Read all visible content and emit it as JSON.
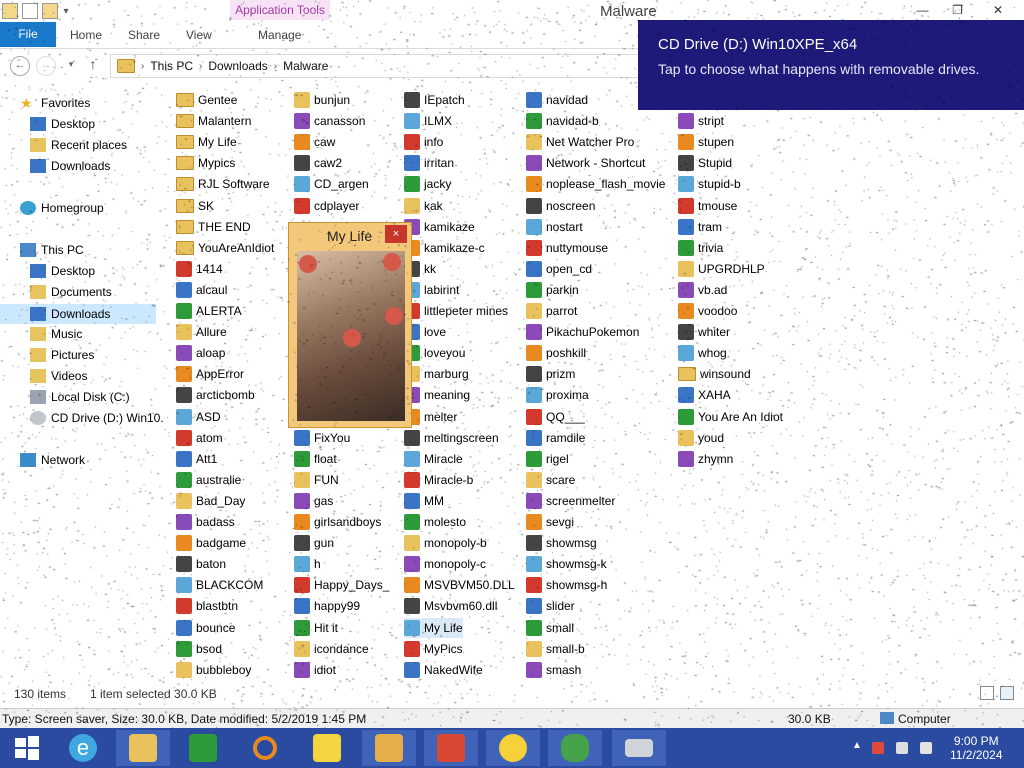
{
  "window": {
    "title": "Malware",
    "context_tab": "Application Tools",
    "minimize_glyph": "—",
    "maximize_glyph": "❐",
    "close_glyph": "✕"
  },
  "ribbon": {
    "file": "File",
    "tabs": [
      "Home",
      "Share",
      "View",
      "Manage"
    ]
  },
  "address": {
    "crumbs": [
      "This PC",
      "Downloads",
      "Malware"
    ],
    "back_glyph": "←",
    "forward_glyph": "→",
    "up_glyph": "↑"
  },
  "sidebar": {
    "items": [
      {
        "label": "Favorites",
        "icon": "star-icon"
      },
      {
        "label": "Desktop",
        "icon": "desktop-icon"
      },
      {
        "label": "Recent places",
        "icon": "recent-places-icon"
      },
      {
        "label": "Downloads",
        "icon": "downloads-icon"
      },
      {
        "label": "Homegroup",
        "icon": "homegroup-icon"
      },
      {
        "label": "This PC",
        "icon": "computer-icon"
      },
      {
        "label": "Desktop",
        "icon": "desktop-icon"
      },
      {
        "label": "Documents",
        "icon": "documents-icon"
      },
      {
        "label": "Downloads",
        "icon": "downloads-icon"
      },
      {
        "label": "Music",
        "icon": "music-icon"
      },
      {
        "label": "Pictures",
        "icon": "pictures-icon"
      },
      {
        "label": "Videos",
        "icon": "videos-icon"
      },
      {
        "label": "Local Disk (C:)",
        "icon": "disk-icon"
      },
      {
        "label": "CD Drive (D:) Win10.",
        "icon": "cd-drive-icon"
      },
      {
        "label": "Network",
        "icon": "network-icon"
      }
    ]
  },
  "files": {
    "col1": [
      {
        "name": "Gentee",
        "icon": "folder"
      },
      {
        "name": "Malantern",
        "icon": "folder"
      },
      {
        "name": "My Life",
        "icon": "folder"
      },
      {
        "name": "Mypics",
        "icon": "folder"
      },
      {
        "name": "RJL Software",
        "icon": "folder"
      },
      {
        "name": "SK",
        "icon": "folder"
      },
      {
        "name": "THE END",
        "icon": "folder"
      },
      {
        "name": "YouAreAnIdiot",
        "icon": "folder"
      },
      {
        "name": "1414",
        "icon": "app"
      },
      {
        "name": "alcaul",
        "icon": "app"
      },
      {
        "name": "ALERTA",
        "icon": "app"
      },
      {
        "name": "Allure",
        "icon": "app"
      },
      {
        "name": "aloap",
        "icon": "app"
      },
      {
        "name": "AppError",
        "icon": "app"
      },
      {
        "name": "arcticbomb",
        "icon": "app"
      },
      {
        "name": "ASD",
        "icon": "app"
      },
      {
        "name": "atom",
        "icon": "app"
      },
      {
        "name": "Att1",
        "icon": "app"
      },
      {
        "name": "australie",
        "icon": "app"
      },
      {
        "name": "Bad_Day",
        "icon": "app"
      },
      {
        "name": "badass",
        "icon": "app"
      },
      {
        "name": "badgame",
        "icon": "app"
      },
      {
        "name": "baton",
        "icon": "app"
      },
      {
        "name": "BLACKCOM",
        "icon": "app"
      },
      {
        "name": "blastbtn",
        "icon": "app"
      },
      {
        "name": "bounce",
        "icon": "app"
      },
      {
        "name": "bsod",
        "icon": "app"
      },
      {
        "name": "bubbleboy",
        "icon": "app"
      }
    ],
    "col2": [
      {
        "name": "bunjun",
        "icon": "app"
      },
      {
        "name": "canasson",
        "icon": "app"
      },
      {
        "name": "caw",
        "icon": "app"
      },
      {
        "name": "caw2",
        "icon": "app"
      },
      {
        "name": "CD_argen",
        "icon": "app"
      },
      {
        "name": "cdplayer",
        "icon": "app"
      },
      {
        "name": "FixYou",
        "icon": "app"
      },
      {
        "name": "float",
        "icon": "app"
      },
      {
        "name": "FUN",
        "icon": "app"
      },
      {
        "name": "gas",
        "icon": "app"
      },
      {
        "name": "girlsandboys",
        "icon": "app"
      },
      {
        "name": "gun",
        "icon": "app"
      },
      {
        "name": "h",
        "icon": "app"
      },
      {
        "name": "Happy_Days_",
        "icon": "app"
      },
      {
        "name": "happy99",
        "icon": "app"
      },
      {
        "name": "Hit it",
        "icon": "app"
      },
      {
        "name": "icondance",
        "icon": "app"
      },
      {
        "name": "idiot",
        "icon": "app"
      }
    ],
    "col3": [
      {
        "name": "IEpatch",
        "icon": "app"
      },
      {
        "name": "ILMX",
        "icon": "app"
      },
      {
        "name": "info",
        "icon": "app"
      },
      {
        "name": "irritan",
        "icon": "app"
      },
      {
        "name": "jacky",
        "icon": "app"
      },
      {
        "name": "kak",
        "icon": "app"
      },
      {
        "name": "kamikaze",
        "icon": "app"
      },
      {
        "name": "kamikaze-c",
        "icon": "app"
      },
      {
        "name": "kk",
        "icon": "app"
      },
      {
        "name": "labirint",
        "icon": "app"
      },
      {
        "name": "littlepeter mines",
        "icon": "app"
      },
      {
        "name": "love",
        "icon": "app"
      },
      {
        "name": "loveyou",
        "icon": "app"
      },
      {
        "name": "marburg",
        "icon": "app"
      },
      {
        "name": "meaning",
        "icon": "app"
      },
      {
        "name": "melter",
        "icon": "app"
      },
      {
        "name": "meltingscreen",
        "icon": "app"
      },
      {
        "name": "Miracle",
        "icon": "app"
      },
      {
        "name": "Miracle-b",
        "icon": "app"
      },
      {
        "name": "MM",
        "icon": "app"
      },
      {
        "name": "molesto",
        "icon": "app"
      },
      {
        "name": "monopoly-b",
        "icon": "app"
      },
      {
        "name": "monopoly-c",
        "icon": "app"
      },
      {
        "name": "MSVBVM50.DLL",
        "icon": "app"
      },
      {
        "name": "Msvbvm60.dll",
        "icon": "app"
      },
      {
        "name": "My Life",
        "icon": "app"
      },
      {
        "name": "MyPics",
        "icon": "app"
      },
      {
        "name": "NakedWife",
        "icon": "app"
      }
    ],
    "col4": [
      {
        "name": "navidad",
        "icon": "app"
      },
      {
        "name": "navidad-b",
        "icon": "app"
      },
      {
        "name": "Net Watcher Pro",
        "icon": "app"
      },
      {
        "name": "Network - Shortcut",
        "icon": "app"
      },
      {
        "name": "noplease_flash_movie",
        "icon": "app"
      },
      {
        "name": "noscreen",
        "icon": "app"
      },
      {
        "name": "nostart",
        "icon": "app"
      },
      {
        "name": "nuttymouse",
        "icon": "app"
      },
      {
        "name": "open_cd",
        "icon": "app"
      },
      {
        "name": "parkin",
        "icon": "app"
      },
      {
        "name": "parrot",
        "icon": "app"
      },
      {
        "name": "PikachuPokemon",
        "icon": "app"
      },
      {
        "name": "poshkill",
        "icon": "app"
      },
      {
        "name": "prizm",
        "icon": "app"
      },
      {
        "name": "proxima",
        "icon": "app"
      },
      {
        "name": "QQ___",
        "icon": "app"
      },
      {
        "name": "ramdile",
        "icon": "app"
      },
      {
        "name": "rigel",
        "icon": "app"
      },
      {
        "name": "scare",
        "icon": "app"
      },
      {
        "name": "screenmelter",
        "icon": "app"
      },
      {
        "name": "sevgi",
        "icon": "app"
      },
      {
        "name": "showmsg",
        "icon": "app"
      },
      {
        "name": "showmsg-k",
        "icon": "app"
      },
      {
        "name": "showmsg-h",
        "icon": "app"
      },
      {
        "name": "slider",
        "icon": "app"
      },
      {
        "name": "small",
        "icon": "app"
      },
      {
        "name": "small-b",
        "icon": "app"
      },
      {
        "name": "smash",
        "icon": "app"
      }
    ],
    "col5": [
      {
        "name": "stript",
        "icon": "app"
      },
      {
        "name": "stupen",
        "icon": "app"
      },
      {
        "name": "Stupid",
        "icon": "app"
      },
      {
        "name": "stupid-b",
        "icon": "app"
      },
      {
        "name": "tmouse",
        "icon": "app"
      },
      {
        "name": "tram",
        "icon": "app"
      },
      {
        "name": "trivia",
        "icon": "app"
      },
      {
        "name": "UPGRDHLP",
        "icon": "app"
      },
      {
        "name": "vb.ad",
        "icon": "app"
      },
      {
        "name": "voodoo",
        "icon": "app"
      },
      {
        "name": "whiter",
        "icon": "app"
      },
      {
        "name": "whog",
        "icon": "app"
      },
      {
        "name": "winsound",
        "icon": "folder"
      },
      {
        "name": "XAHA",
        "icon": "app"
      },
      {
        "name": "You Are An Idiot",
        "icon": "app"
      },
      {
        "name": "youd",
        "icon": "app"
      },
      {
        "name": "zhymn",
        "icon": "app"
      }
    ]
  },
  "toast": {
    "title": "CD Drive (D:) Win10XPE_x64",
    "body": "Tap to choose what happens with removable drives."
  },
  "popup": {
    "title": "My Life",
    "close_glyph": "×"
  },
  "status": {
    "items": "130 items",
    "selected": "1 item selected  30.0 KB",
    "details": "Type: Screen saver, Size: 30.0 KB, Date modified: 5/2/2019 1:45 PM",
    "size": "30.0 KB",
    "location": "Computer"
  },
  "taskbar": {
    "apps": [
      "start",
      "internet-explorer",
      "file-explorer",
      "store",
      "search-magnifier",
      "lightning-app",
      "media-app",
      "red-app",
      "sun-app",
      "frog-app",
      "keyboard-app"
    ],
    "time": "9:00 PM",
    "date": "11/2/2024"
  },
  "colors": {
    "file_tab": "#1979ca",
    "toast": "#1e1a7a",
    "taskbar": "#2a4ba0",
    "context_tab": "#a33ca5"
  }
}
